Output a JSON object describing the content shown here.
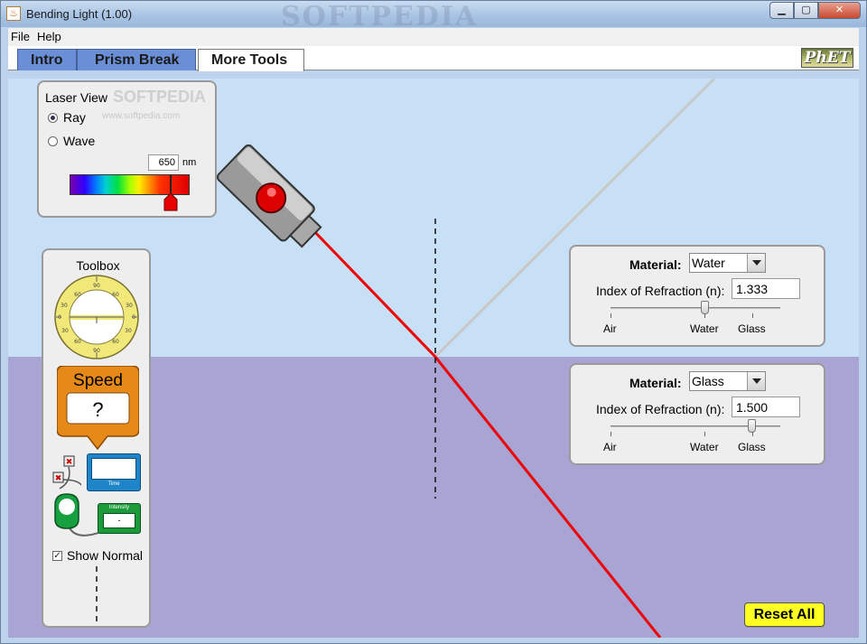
{
  "window": {
    "title": "Bending Light (1.00)",
    "watermark": "SOFTPEDIA",
    "controls": [
      "minimize",
      "maximize",
      "close"
    ]
  },
  "menu": {
    "items": [
      {
        "label": "File"
      },
      {
        "label": "Help"
      }
    ]
  },
  "tabs": [
    {
      "label": "Intro",
      "active": false
    },
    {
      "label": "Prism Break",
      "active": false
    },
    {
      "label": "More Tools",
      "active": true
    }
  ],
  "logo": {
    "text": "PhET"
  },
  "laser_view": {
    "title": "Laser View",
    "watermark": "SOFTPEDIA",
    "watermark_url": "www.softpedia.com",
    "options": [
      {
        "label": "Ray",
        "selected": true
      },
      {
        "label": "Wave",
        "selected": false
      }
    ],
    "wavelength_value": "650",
    "wavelength_unit": "nm"
  },
  "toolbox": {
    "title": "Toolbox",
    "speed_label": "Speed",
    "speed_value": "?",
    "time_label": "Time",
    "intensity_label": "Intensity",
    "intensity_value": "-",
    "show_normal_label": "Show Normal",
    "show_normal_checked": true,
    "protractor_ticks": [
      "90",
      "60",
      "30",
      "0",
      "30",
      "60",
      "90"
    ]
  },
  "materials": [
    {
      "label": "Material:",
      "selected": "Water",
      "ior_label": "Index of Refraction (n):",
      "ior_value": "1.333",
      "slider_fraction": 0.56,
      "ticks": [
        "Air",
        "Water",
        "Glass"
      ]
    },
    {
      "label": "Material:",
      "selected": "Glass",
      "ior_label": "Index of Refraction (n):",
      "ior_value": "1.500",
      "slider_fraction": 0.84,
      "ticks": [
        "Air",
        "Water",
        "Glass"
      ]
    }
  ],
  "reset_button": {
    "label": "Reset All"
  },
  "colors": {
    "air": "#c7e0f5",
    "medium": "#a8a4d4",
    "laser_beam": "#ee0000",
    "reflected_beam": "#c8c8c8",
    "tab_inactive": "#6a8fd6",
    "reset": "#ffff22"
  }
}
